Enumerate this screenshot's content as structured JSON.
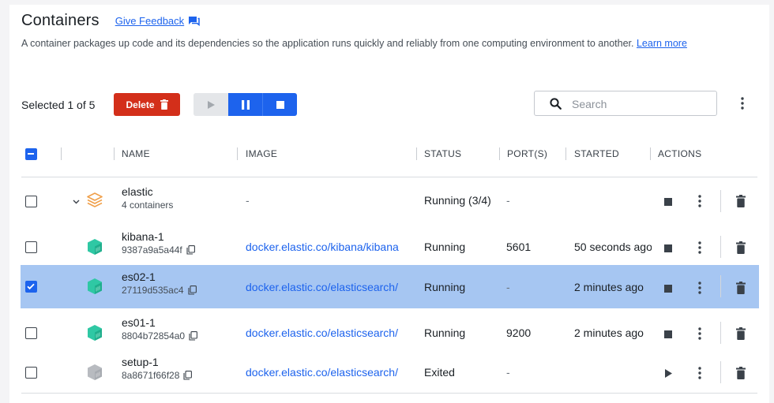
{
  "header": {
    "title": "Containers",
    "feedback_label": "Give Feedback",
    "description": "A container packages up code and its dependencies so the application runs quickly and reliably from one computing environment to another.",
    "learn_more_label": "Learn more"
  },
  "toolbar": {
    "selected_text": "Selected 1 of 5",
    "delete_label": "Delete",
    "search_placeholder": "Search"
  },
  "table": {
    "columns": {
      "name": "NAME",
      "image": "IMAGE",
      "status": "STATUS",
      "ports": "PORT(S)",
      "started": "STARTED",
      "actions": "ACTIONS"
    },
    "rows": [
      {
        "name": "elastic",
        "sub": "4 containers",
        "image": "-",
        "status": "Running (3/4)",
        "ports": "-",
        "started": "",
        "checked": false,
        "icon": "compose-stack-icon"
      },
      {
        "name": "kibana-1",
        "sub": "9387a9a5a44f",
        "image": "docker.elastic.co/kibana/kibana",
        "status": "Running",
        "ports": "5601",
        "started": "50 seconds ago",
        "checked": false,
        "icon": "container-running-icon"
      },
      {
        "name": "es02-1",
        "sub": "27119d535ac4",
        "image": "docker.elastic.co/elasticsearch/",
        "status": "Running",
        "ports": "-",
        "started": "2 minutes ago",
        "checked": true,
        "icon": "container-running-icon"
      },
      {
        "name": "es01-1",
        "sub": "8804b72854a0",
        "image": "docker.elastic.co/elasticsearch/",
        "status": "Running",
        "ports": "9200",
        "started": "2 minutes ago",
        "checked": false,
        "icon": "container-running-icon"
      },
      {
        "name": "setup-1",
        "sub": "8a8671f66f28",
        "image": "docker.elastic.co/elasticsearch/",
        "status": "Exited",
        "ports": "-",
        "started": "",
        "checked": false,
        "icon": "container-exited-icon"
      }
    ]
  },
  "colors": {
    "accent": "#1d63ed",
    "danger": "#d32f1a",
    "selected_row": "#a6c6f2",
    "running_icon": "#2fc8a4",
    "exited_icon": "#a7abb1",
    "stack_icon": "#f0a04b"
  }
}
